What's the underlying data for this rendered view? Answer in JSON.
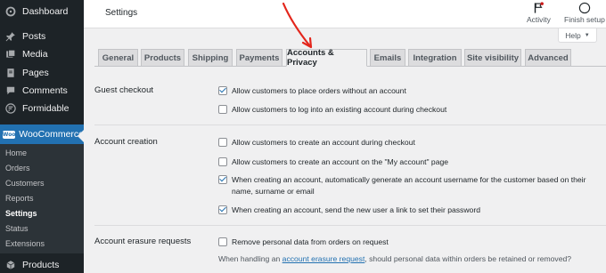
{
  "sidebar": {
    "items": [
      {
        "label": "Dashboard",
        "icon": "dashboard-icon"
      },
      {
        "label": "Posts",
        "icon": "pin-icon"
      },
      {
        "label": "Media",
        "icon": "media-icon"
      },
      {
        "label": "Pages",
        "icon": "pages-icon"
      },
      {
        "label": "Comments",
        "icon": "comments-icon"
      },
      {
        "label": "Formidable",
        "icon": "formidable-icon"
      }
    ],
    "woocommerce": {
      "label": "WooCommerce",
      "icon_text": "Woo"
    },
    "submenu": [
      "Home",
      "Orders",
      "Customers",
      "Reports",
      "Settings",
      "Status",
      "Extensions"
    ],
    "products": {
      "label": "Products"
    }
  },
  "topbar": {
    "title": "Settings",
    "activity": "Activity",
    "finish_setup": "Finish setup"
  },
  "help": {
    "label": "Help",
    "arrow": "▼"
  },
  "tabs": [
    "General",
    "Products",
    "Shipping",
    "Payments",
    "Accounts & Privacy",
    "Emails",
    "Integration",
    "Site visibility",
    "Advanced"
  ],
  "active_tab": "Accounts & Privacy",
  "sections": {
    "guest_checkout": {
      "label": "Guest checkout",
      "options": [
        {
          "text": "Allow customers to place orders without an account",
          "checked": true
        },
        {
          "text": "Allow customers to log into an existing account during checkout",
          "checked": false
        }
      ]
    },
    "account_creation": {
      "label": "Account creation",
      "options": [
        {
          "text": "Allow customers to create an account during checkout",
          "checked": false
        },
        {
          "text": "Allow customers to create an account on the \"My account\" page",
          "checked": false
        },
        {
          "text": "When creating an account, automatically generate an account username for the customer based on their name, surname or email",
          "checked": true
        },
        {
          "text": "When creating an account, send the new user a link to set their password",
          "checked": true
        }
      ]
    },
    "erasure": {
      "label": "Account erasure requests",
      "options": [
        {
          "text": "Remove personal data from orders on request",
          "checked": false
        }
      ],
      "desc_before": "When handling an ",
      "desc_link": "account erasure request",
      "desc_after": ", should personal data within orders be retained or removed?"
    }
  },
  "colors": {
    "accent": "#2271b1",
    "sidebar": "#1d2327",
    "annotation": "#e3261c"
  }
}
